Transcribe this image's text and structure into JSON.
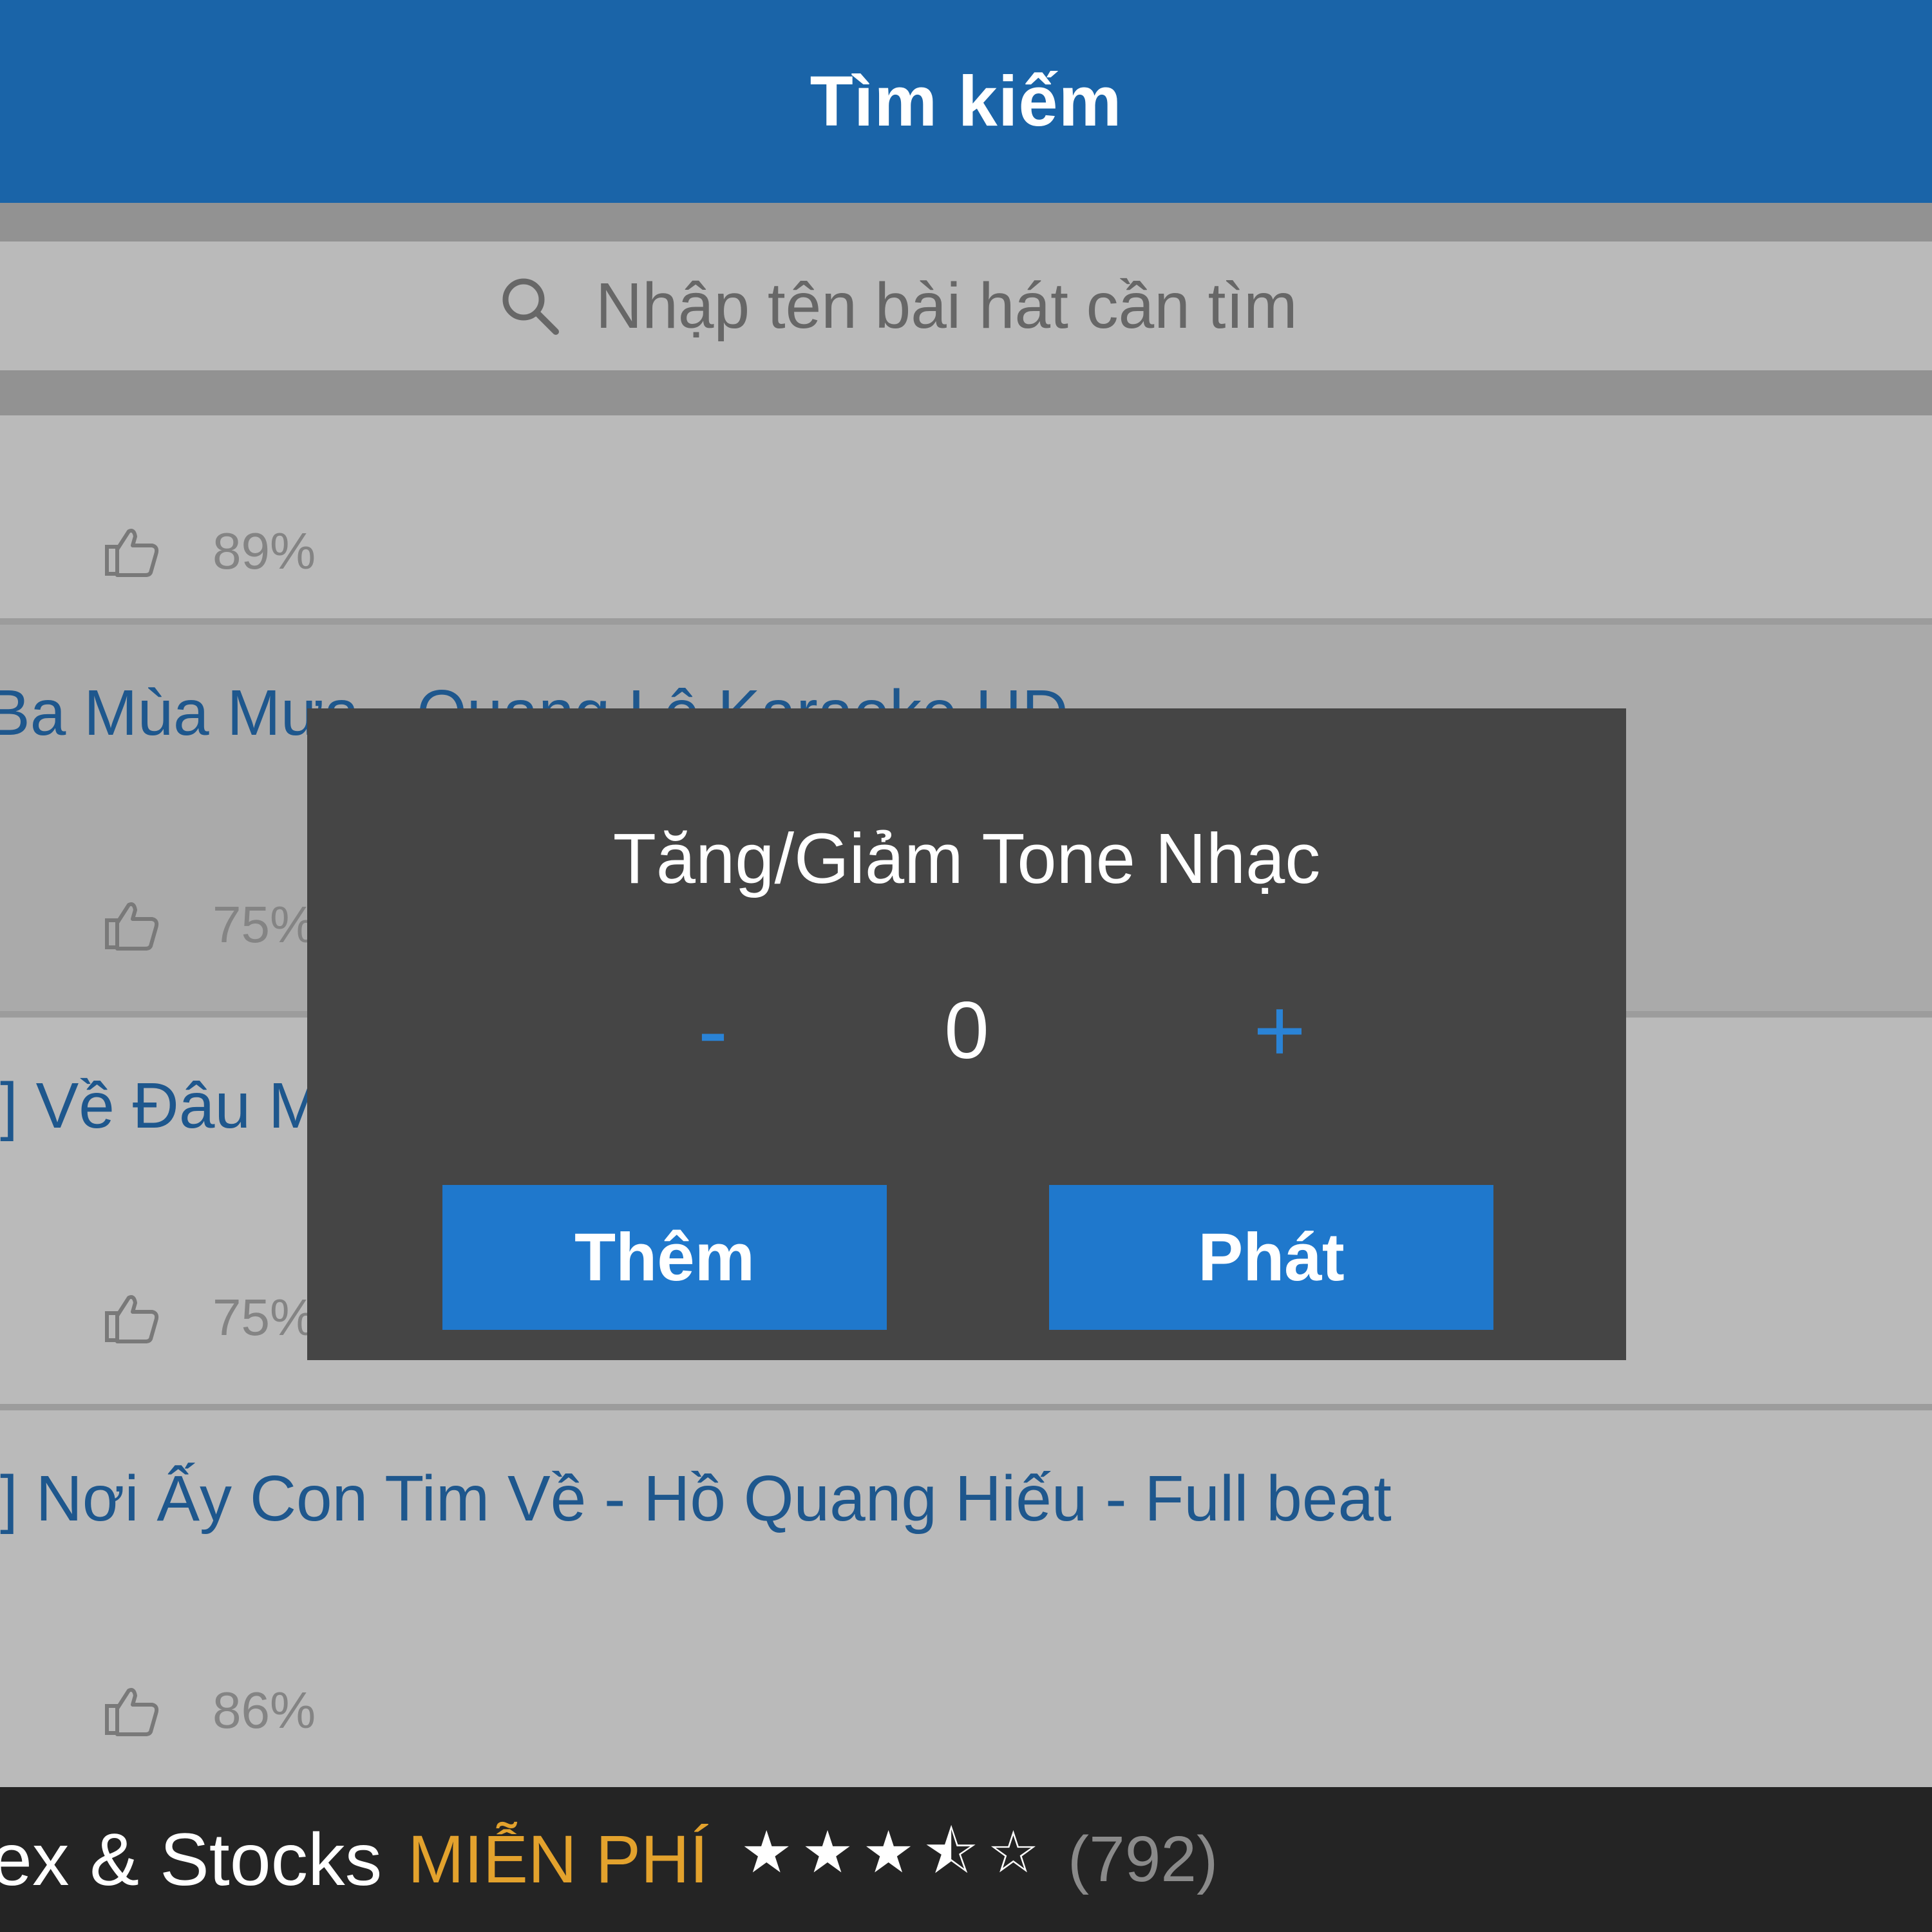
{
  "header": {
    "title": "Tìm kiếm"
  },
  "search": {
    "placeholder": "Nhập tên bài hát cần tìm"
  },
  "songs": [
    {
      "title": "",
      "rating": "89%"
    },
    {
      "title": "Ba Mùa Mưa - Quang Lê Karaoke HD",
      "rating": "75%"
    },
    {
      "title": "] Về Đâu Mái Tóc Người Thương - Quang Lê",
      "rating": "75%"
    },
    {
      "title": "] Nơi Ấy Con Tim Về - Hồ Quang Hiếu - Full beat",
      "rating": "86%"
    }
  ],
  "dialog": {
    "title": "Tăng/Giảm Tone Nhạc",
    "minus_label": "-",
    "value": "0",
    "plus_label": "+",
    "add_label": "Thêm",
    "play_label": "Phát"
  },
  "ad": {
    "app_name": "ex & Stocks",
    "price": "MIỄN PHÍ",
    "stars": "★★★⯪☆",
    "rating_value": 3.5,
    "review_count": "(792)"
  },
  "colors": {
    "header": "#1a64a8",
    "link": "#2a78c2",
    "button": "#1f78cc",
    "dialog_bg": "#454545",
    "free_label": "#e3a22d"
  },
  "icons": {
    "search": "search-icon",
    "like": "thumbs-up-icon"
  }
}
